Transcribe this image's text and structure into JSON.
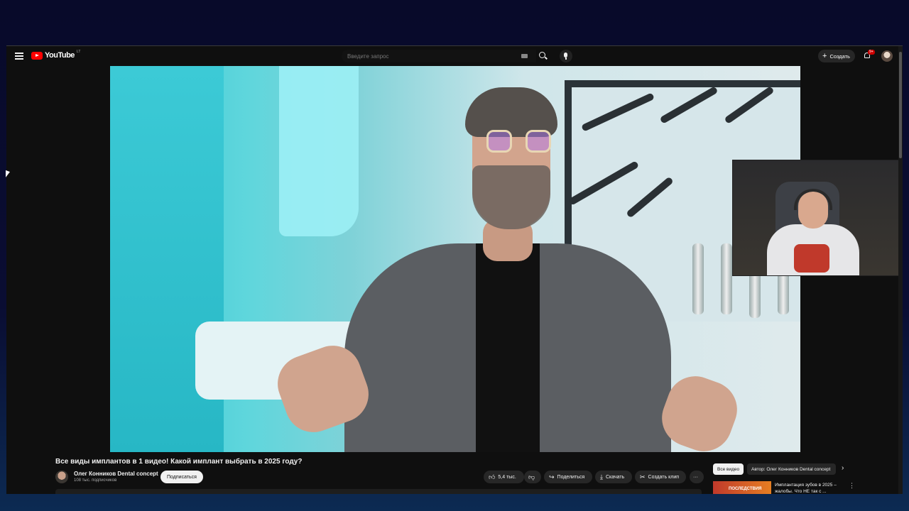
{
  "topbar": {
    "logo_text": "YouTube",
    "logo_sup": "LT",
    "search_placeholder": "Введите запрос",
    "create_label": "Создать",
    "notification_badge": "9+",
    "icons": [
      "menu-icon",
      "search-icon",
      "mic-icon",
      "plus-icon",
      "bell-icon",
      "keyboard-icon"
    ]
  },
  "video": {
    "title": "Все виды имплантов в 1 видео! Какой имплант выбрать в 2025 году?",
    "channel_name": "Олег Конников Dental concept",
    "subscribers": "108 тыс. подписчиков",
    "subscribe_label": "Подписаться"
  },
  "actions": {
    "likes": "5,4 тыс.",
    "share_label": "Поделиться",
    "download_label": "Скачать",
    "clip_label": "Создать клип",
    "more_label": "···"
  },
  "sidebar": {
    "chips": [
      "Все видео",
      "Автор: Олег Конников Dental concept"
    ],
    "next_label": "›",
    "recommended": {
      "thumb_label": "ПОСЛЕДСТВИЯ",
      "title": "Имплантация зубов в 2025 – жалобы. Что НЕ так с ..."
    }
  },
  "colors": {
    "brand_red": "#ff0000",
    "background": "#0f0f0f",
    "pill": "#272727"
  }
}
